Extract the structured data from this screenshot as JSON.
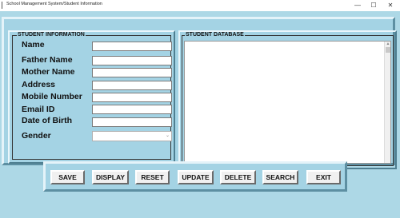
{
  "window": {
    "title": "School Management System/Student Information",
    "controls": {
      "minimize": "—",
      "maximize": "☐",
      "close": "✕"
    }
  },
  "student_info": {
    "title": "STUDENT INFORMATION",
    "fields": {
      "name": {
        "label": "Name",
        "value": ""
      },
      "father_name": {
        "label": "Father Name",
        "value": ""
      },
      "mother_name": {
        "label": "Mother Name",
        "value": ""
      },
      "address": {
        "label": "Address",
        "value": ""
      },
      "mobile_number": {
        "label": "Mobile Number",
        "value": ""
      },
      "email_id": {
        "label": "Email ID",
        "value": ""
      },
      "date_of_birth": {
        "label": "Date of Birth",
        "value": ""
      },
      "gender": {
        "label": "Gender",
        "value": ""
      }
    }
  },
  "student_database": {
    "title": "STUDENT DATABASE",
    "rows": []
  },
  "buttons": {
    "save": "SAVE",
    "display": "DISPLAY",
    "reset": "RESET",
    "update": "UPDATE",
    "delete": "DELETE",
    "search": "SEARCH",
    "exit": "EXIT"
  },
  "colors": {
    "window_background": "#add8e6",
    "panel_background": "#a4d3e4",
    "button_face": "#f0f0f0"
  }
}
